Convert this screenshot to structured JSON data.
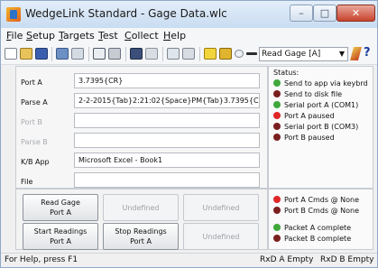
{
  "window": {
    "title": "WedgeLink Standard - Gage Data.wlc"
  },
  "menu": [
    "File",
    "Setup",
    "Targets",
    "Test",
    "Collect",
    "Help"
  ],
  "toolbar": {
    "gage_select": "Read Gage  [A]",
    "help": "?"
  },
  "fields": [
    {
      "label": "Port A",
      "value": "3.7395{CR}",
      "enabled": true
    },
    {
      "label": "Parse A",
      "value": "2-2-2015{Tab}2:21:02{Space}PM{Tab}3.7395{CR}",
      "enabled": true
    },
    {
      "label": "Port B",
      "value": "",
      "enabled": false
    },
    {
      "label": "Parse B",
      "value": "",
      "enabled": false
    },
    {
      "label": "K/B App",
      "value": "Microsoft Excel - Book1",
      "enabled": true
    },
    {
      "label": "File",
      "value": "",
      "enabled": true
    }
  ],
  "status": {
    "title": "Status:",
    "items": [
      {
        "text": "Send to app via keybrd",
        "color": "#3fa83a"
      },
      {
        "text": "Send to disk file",
        "color": "#7a1f1f"
      },
      {
        "text": "Serial port A (COM1)",
        "color": "#3fa83a"
      },
      {
        "text": "Port A paused",
        "color": "#e02626"
      },
      {
        "text": "Serial port B (COM3)",
        "color": "#7a1f1f"
      },
      {
        "text": "Port B paused",
        "color": "#7a1f1f"
      }
    ]
  },
  "buttons": {
    "read_gage": "Read Gage\nPort A",
    "undefined_1": "Undefined",
    "undefined_2": "Undefined",
    "start_readings": "Start Readings\nPort A",
    "stop_readings": "Stop Readings\nPort A",
    "undefined_3": "Undefined"
  },
  "cmd_status": [
    {
      "text": "Port A Cmds @ None",
      "color": "#e02626"
    },
    {
      "text": "Port B Cmds @ None",
      "color": "#7a1f1f"
    },
    {
      "text": "Packet A complete",
      "color": "#3fa83a"
    },
    {
      "text": "Packet B complete",
      "color": "#7a1f1f"
    }
  ],
  "statusbar": {
    "help_text": "For Help, press F1",
    "rxd_a": "RxD A Empty",
    "rxd_b": "RxD B Empty"
  }
}
